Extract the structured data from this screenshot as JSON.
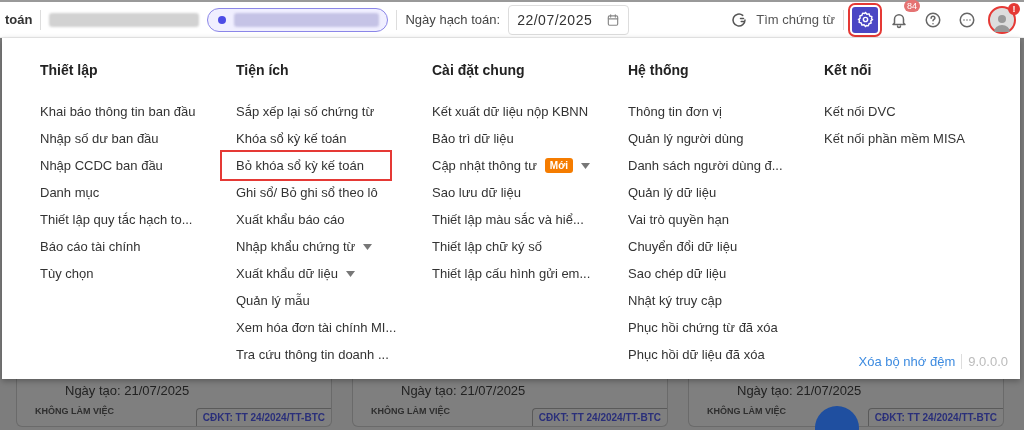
{
  "top_bar": {
    "title": "toán",
    "date_label": "Ngày hạch toán:",
    "date_value": "22/07/2025",
    "search_label": "Tìm chứng từ",
    "settings_highlighted": true,
    "notification_count": "84",
    "avatar_alert": "!",
    "avatar_highlighted": true
  },
  "menu": {
    "columns": [
      {
        "heading": "Thiết lập",
        "items": [
          {
            "label": "Khai báo thông tin ban đầu",
            "highlighted": false,
            "has_submenu": false
          },
          {
            "label": "Nhập số dư ban đầu",
            "highlighted": false,
            "has_submenu": false
          },
          {
            "label": "Nhập CCDC ban đầu",
            "highlighted": false,
            "has_submenu": false
          },
          {
            "label": "Danh mục",
            "highlighted": false,
            "has_submenu": false
          },
          {
            "label": "Thiết lập quy tắc hạch to...",
            "highlighted": false,
            "has_submenu": false
          },
          {
            "label": "Báo cáo tài chính",
            "highlighted": false,
            "has_submenu": false
          },
          {
            "label": "Tùy chọn",
            "highlighted": false,
            "has_submenu": false
          }
        ]
      },
      {
        "heading": "Tiện ích",
        "items": [
          {
            "label": "Sắp xếp lại số chứng từ",
            "highlighted": false,
            "has_submenu": false
          },
          {
            "label": "Khóa sổ kỳ kế toán",
            "highlighted": false,
            "has_submenu": false
          },
          {
            "label": "Bỏ khóa sổ kỳ kế toán",
            "highlighted": true,
            "has_submenu": false
          },
          {
            "label": "Ghi sổ/ Bỏ ghi sổ theo lô",
            "highlighted": false,
            "has_submenu": false
          },
          {
            "label": "Xuất khẩu báo cáo",
            "highlighted": false,
            "has_submenu": false
          },
          {
            "label": "Nhập khẩu chứng từ",
            "highlighted": false,
            "has_submenu": true
          },
          {
            "label": "Xuất khẩu dữ liệu",
            "highlighted": false,
            "has_submenu": true
          },
          {
            "label": "Quản lý mẫu",
            "highlighted": false,
            "has_submenu": false
          },
          {
            "label": "Xem hóa đơn tài chính MI...",
            "highlighted": false,
            "has_submenu": false
          },
          {
            "label": "Tra cứu thông tin doanh ...",
            "highlighted": false,
            "has_submenu": false
          }
        ]
      },
      {
        "heading": "Cài đặt chung",
        "items": [
          {
            "label": "Kết xuất dữ liệu nộp KBNN",
            "highlighted": false,
            "has_submenu": false
          },
          {
            "label": "Bảo trì dữ liệu",
            "highlighted": false,
            "has_submenu": false
          },
          {
            "label": "Cập nhật thông tư",
            "highlighted": false,
            "has_submenu": true,
            "badge": "Mới"
          },
          {
            "label": "Sao lưu dữ liệu",
            "highlighted": false,
            "has_submenu": false
          },
          {
            "label": "Thiết lập màu sắc và hiể...",
            "highlighted": false,
            "has_submenu": false
          },
          {
            "label": "Thiết lập chữ ký số",
            "highlighted": false,
            "has_submenu": false
          },
          {
            "label": "Thiết lập cấu hình gửi em...",
            "highlighted": false,
            "has_submenu": false
          }
        ]
      },
      {
        "heading": "Hệ thống",
        "items": [
          {
            "label": "Thông tin đơn vị",
            "highlighted": false,
            "has_submenu": false
          },
          {
            "label": "Quản lý người dùng",
            "highlighted": false,
            "has_submenu": false
          },
          {
            "label": "Danh sách người dùng đ...",
            "highlighted": false,
            "has_submenu": false
          },
          {
            "label": "Quản lý dữ liệu",
            "highlighted": false,
            "has_submenu": false
          },
          {
            "label": "Vai trò quyền hạn",
            "highlighted": false,
            "has_submenu": false
          },
          {
            "label": "Chuyển đổi dữ liệu",
            "highlighted": false,
            "has_submenu": false
          },
          {
            "label": "Sao chép dữ liệu",
            "highlighted": false,
            "has_submenu": false
          },
          {
            "label": "Nhật ký truy cập",
            "highlighted": false,
            "has_submenu": false
          },
          {
            "label": "Phục hồi chứng từ đã xóa",
            "highlighted": false,
            "has_submenu": false
          },
          {
            "label": "Phục hồi dữ liệu đã xóa",
            "highlighted": false,
            "has_submenu": false
          }
        ]
      },
      {
        "heading": "Kết nối",
        "items": [
          {
            "label": "Kết nối DVC",
            "highlighted": false,
            "has_submenu": false
          },
          {
            "label": "Kết nối phần mềm MISA",
            "highlighted": false,
            "has_submenu": false
          }
        ]
      }
    ],
    "footer": {
      "link": "Xóa bộ nhớ đệm",
      "version": "9.0.0.0"
    }
  },
  "cards": [
    {
      "date": "Ngày tạo: 21/07/2025",
      "status": "KHÔNG LÀM VIỆC",
      "tag": "CĐKT: TT 24/2024/TT-BTC"
    },
    {
      "date": "Ngày tạo: 21/07/2025",
      "status": "KHÔNG LÀM VIỆC",
      "tag": "CĐKT: TT 24/2024/TT-BTC"
    },
    {
      "date": "Ngày tạo: 21/07/2025",
      "status": "KHÔNG LÀM VIỆC",
      "tag": "CĐKT: TT 24/2024/TT-BTC"
    }
  ]
}
